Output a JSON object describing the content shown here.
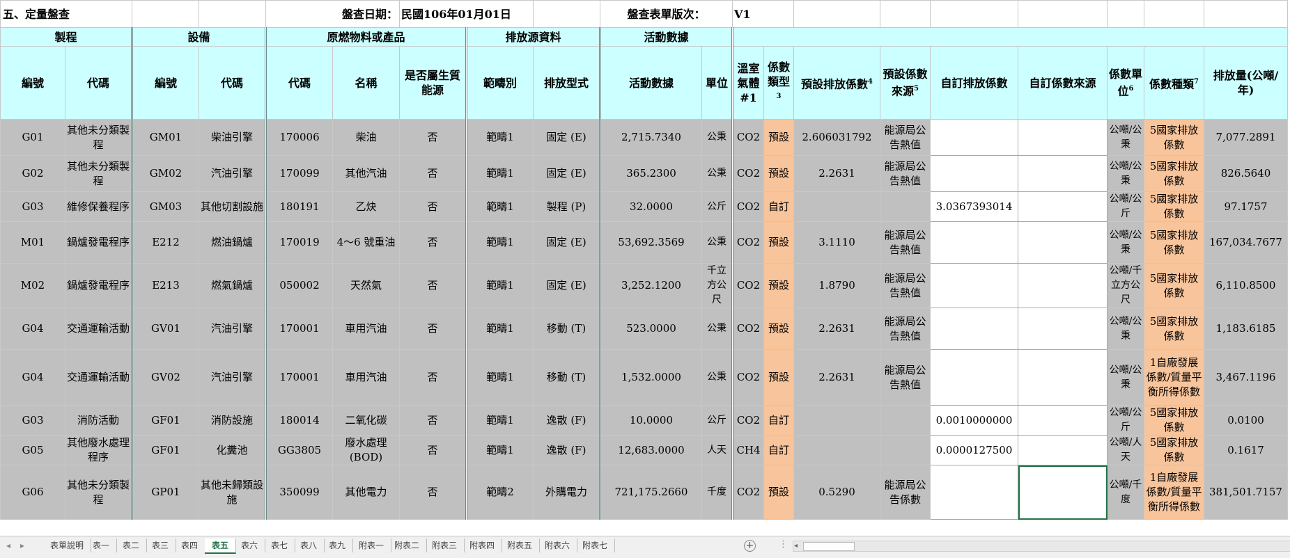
{
  "sheet": {
    "section_title": "五、定量盤查",
    "date_label": "盤查日期：",
    "date_value": "民國106年01月01日",
    "version_label": "盤查表單版次：",
    "version_value": "V1"
  },
  "groups": {
    "process": "製程",
    "equipment": "設備",
    "material": "原燃物料或產品",
    "emission_source": "排放源資料",
    "activity": "活動數據"
  },
  "headers": {
    "process_no": "編號",
    "process_code": "代碼",
    "equip_no": "編號",
    "equip_code": "代碼",
    "material_code": "代碼",
    "material_name": "名稱",
    "biomass": "是否屬生質能源",
    "scope": "範疇別",
    "emission_type": "排放型式",
    "activity_data": "活動數據",
    "unit": "單位",
    "ghg": "溫室氣體#1",
    "factor_type": "係數類型",
    "factor_type_sup": "3",
    "default_factor": "預設排放係數",
    "default_factor_sup": "4",
    "default_source": "預設係數來源",
    "default_source_sup": "5",
    "custom_factor": "自訂排放係數",
    "custom_source": "自訂係數來源",
    "factor_unit": "係數單位",
    "factor_unit_sup": "6",
    "factor_kind": "係數種類",
    "factor_kind_sup": "7",
    "emission": "排放量(公噸/年)"
  },
  "rows": [
    {
      "no": "G01",
      "proc": "其他未分類製程",
      "eno": "GM01",
      "ecode": "柴油引擎",
      "mcode": "170006",
      "mname": "柴油",
      "bio": "否",
      "scope": "範疇1",
      "etype": "固定 (E)",
      "act": "2,715.7340",
      "unit": "公秉",
      "ghg": "CO2",
      "ftype": "預設",
      "dfac": "2.606031792",
      "dsrc": "能源局公告熱值",
      "cfac": "",
      "csrc": "",
      "funit": "公噸/公秉",
      "fkind": "5國家排放係數",
      "em": "7,077.2891"
    },
    {
      "no": "G02",
      "proc": "其他未分類製程",
      "eno": "GM02",
      "ecode": "汽油引擎",
      "mcode": "170099",
      "mname": "其他汽油",
      "bio": "否",
      "scope": "範疇1",
      "etype": "固定 (E)",
      "act": "365.2300",
      "unit": "公秉",
      "ghg": "CO2",
      "ftype": "預設",
      "dfac": "2.2631",
      "dsrc": "能源局公告熱值",
      "cfac": "",
      "csrc": "",
      "funit": "公噸/公秉",
      "fkind": "5國家排放係數",
      "em": "826.5640"
    },
    {
      "no": "G03",
      "proc": "維修保養程序",
      "eno": "GM03",
      "ecode": "其他切割設施",
      "mcode": "180191",
      "mname": "乙炔",
      "bio": "否",
      "scope": "範疇1",
      "etype": "製程 (P)",
      "act": "32.0000",
      "unit": "公斤",
      "ghg": "CO2",
      "ftype": "自訂",
      "dfac": "",
      "dsrc": "",
      "cfac": "3.0367393014",
      "csrc": "",
      "funit": "公噸/公斤",
      "fkind": "5國家排放係數",
      "em": "97.1757"
    },
    {
      "no": "M01",
      "proc": "鍋爐發電程序",
      "eno": "E212",
      "ecode": "燃油鍋爐",
      "mcode": "170019",
      "mname": "4～6 號重油",
      "bio": "否",
      "scope": "範疇1",
      "etype": "固定 (E)",
      "act": "53,692.3569",
      "unit": "公秉",
      "ghg": "CO2",
      "ftype": "預設",
      "dfac": "3.1110",
      "dsrc": "能源局公告熱值",
      "cfac": "",
      "csrc": "",
      "funit": "公噸/公秉",
      "fkind": "5國家排放係數",
      "em": "167,034.7677"
    },
    {
      "no": "M02",
      "proc": "鍋爐發電程序",
      "eno": "E213",
      "ecode": "燃氣鍋爐",
      "mcode": "050002",
      "mname": "天然氣",
      "bio": "否",
      "scope": "範疇1",
      "etype": "固定 (E)",
      "act": "3,252.1200",
      "unit": "千立方公尺",
      "ghg": "CO2",
      "ftype": "預設",
      "dfac": "1.8790",
      "dsrc": "能源局公告熱值",
      "cfac": "",
      "csrc": "",
      "funit": "公噸/千立方公尺",
      "fkind": "5國家排放係數",
      "em": "6,110.8500"
    },
    {
      "no": "G04",
      "proc": "交通運輸活動",
      "eno": "GV01",
      "ecode": "汽油引擎",
      "mcode": "170001",
      "mname": "車用汽油",
      "bio": "否",
      "scope": "範疇1",
      "etype": "移動 (T)",
      "act": "523.0000",
      "unit": "公秉",
      "ghg": "CO2",
      "ftype": "預設",
      "dfac": "2.2631",
      "dsrc": "能源局公告熱值",
      "cfac": "",
      "csrc": "",
      "funit": "公噸/公秉",
      "fkind": "5國家排放係數",
      "em": "1,183.6185"
    },
    {
      "no": "G04",
      "proc": "交通運輸活動",
      "eno": "GV02",
      "ecode": "汽油引擎",
      "mcode": "170001",
      "mname": "車用汽油",
      "bio": "否",
      "scope": "範疇1",
      "etype": "移動 (T)",
      "act": "1,532.0000",
      "unit": "公秉",
      "ghg": "CO2",
      "ftype": "預設",
      "dfac": "2.2631",
      "dsrc": "能源局公告熱值",
      "cfac": "",
      "csrc": "",
      "funit": "公噸/公秉",
      "fkind": "1自廠發展係數/質量平衡所得係數",
      "em": "3,467.1196"
    },
    {
      "no": "G03",
      "proc": "消防活動",
      "eno": "GF01",
      "ecode": "消防設施",
      "mcode": "180014",
      "mname": "二氧化碳",
      "bio": "否",
      "scope": "範疇1",
      "etype": "逸散 (F)",
      "act": "10.0000",
      "unit": "公斤",
      "ghg": "CO2",
      "ftype": "自訂",
      "dfac": "",
      "dsrc": "",
      "cfac": "0.0010000000",
      "csrc": "",
      "funit": "公噸/公斤",
      "fkind": "5國家排放係數",
      "em": "0.0100"
    },
    {
      "no": "G05",
      "proc": "其他廢水處理程序",
      "eno": "GF01",
      "ecode": "化糞池",
      "mcode": "GG3805",
      "mname": "廢水處理(BOD)",
      "bio": "否",
      "scope": "範疇1",
      "etype": "逸散 (F)",
      "act": "12,683.0000",
      "unit": "人天",
      "ghg": "CH4",
      "ftype": "自訂",
      "dfac": "",
      "dsrc": "",
      "cfac": "0.0000127500",
      "csrc": "",
      "funit": "公噸/人天",
      "fkind": "5國家排放係數",
      "em": "0.1617"
    },
    {
      "no": "G06",
      "proc": "其他未分類製程",
      "eno": "GP01",
      "ecode": "其他未歸類設施",
      "mcode": "350099",
      "mname": "其他電力",
      "bio": "否",
      "scope": "範疇2",
      "etype": "外購電力",
      "act": "721,175.2660",
      "unit": "千度",
      "ghg": "CO2",
      "ftype": "預設",
      "dfac": "0.5290",
      "dsrc": "能源局公告係數",
      "cfac": "",
      "csrc": "",
      "funit": "公噸/千度",
      "fkind": "1自廠發展係數/質量平衡所得係數",
      "em": "381,501.7157"
    }
  ],
  "tabs": [
    "表單說明",
    "表一",
    "表二",
    "表三",
    "表四",
    "表五",
    "表六",
    "表七",
    "表八",
    "表九",
    "附表一",
    "附表二",
    "附表三",
    "附表四",
    "附表五",
    "附表六",
    "附表七"
  ],
  "active_tab": "表五",
  "colors": {
    "header_bg": "#ccffff",
    "data_bg": "#c0c0c0",
    "orange": "#f8c49b",
    "excel_green": "#217346"
  }
}
